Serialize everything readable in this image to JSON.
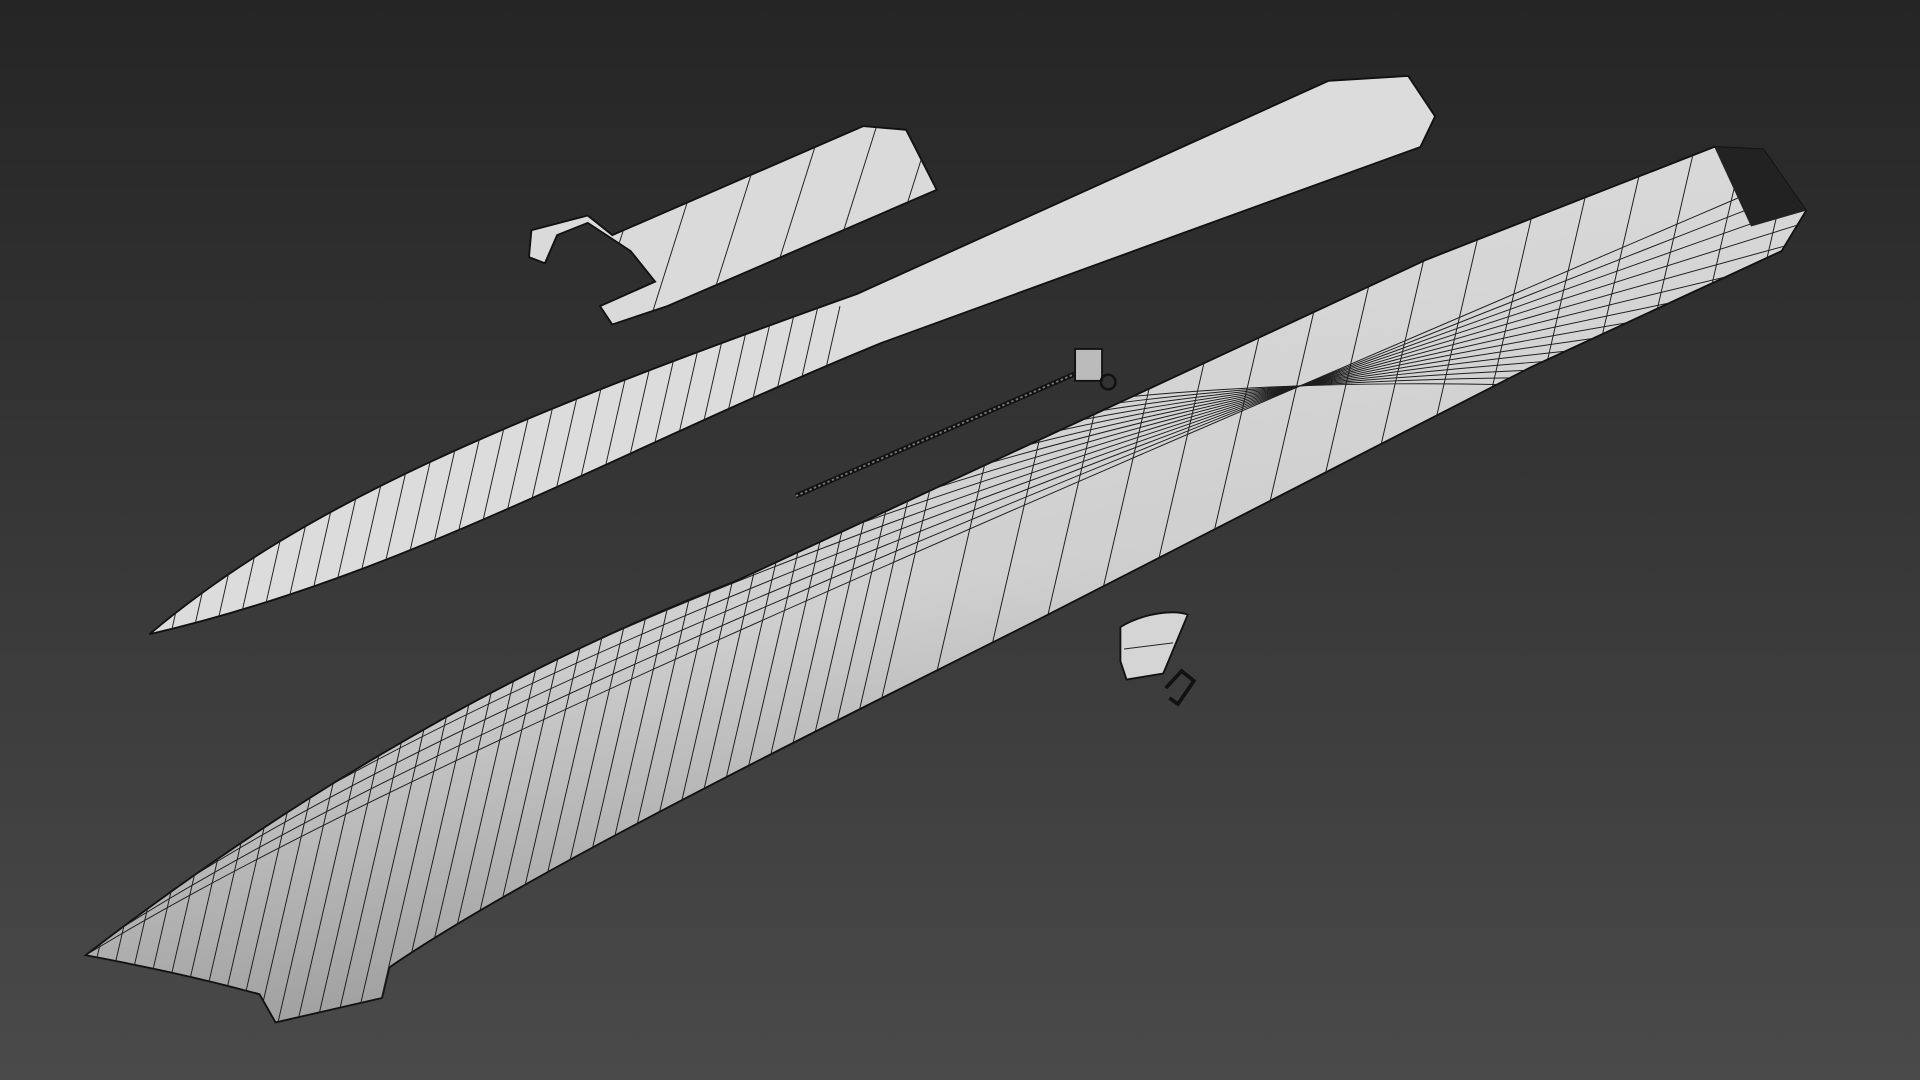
{
  "scene": {
    "background_top": "#252525",
    "background_bottom": "#4a4a4a",
    "surface_color": "#d9d9d9",
    "shade_color": "#9a9a9a",
    "wire_color": "#1a1a1a",
    "objects": [
      "deck-plate",
      "superstructure-plate",
      "hull",
      "propeller-shaft",
      "rudder",
      "rudder-bracket"
    ]
  }
}
